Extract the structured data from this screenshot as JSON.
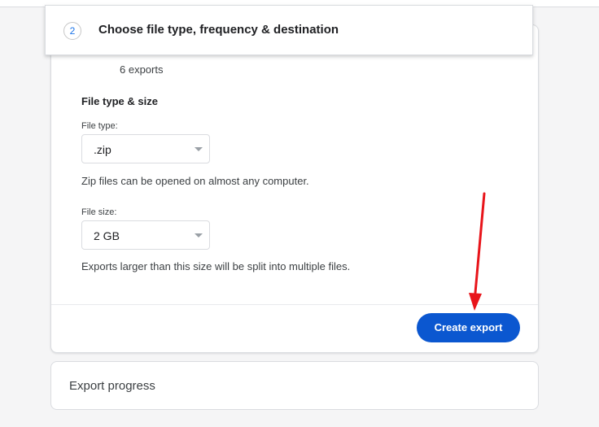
{
  "step": {
    "number": "2",
    "title": "Choose file type, frequency & destination"
  },
  "exports_count": "6 exports",
  "file_section": {
    "heading": "File type & size",
    "type_label": "File type:",
    "type_value": ".zip",
    "type_help": "Zip files can be opened on almost any computer.",
    "size_label": "File size:",
    "size_value": "2 GB",
    "size_help": "Exports larger than this size will be split into multiple files."
  },
  "actions": {
    "create_label": "Create export"
  },
  "progress": {
    "title": "Export progress"
  },
  "colors": {
    "primary": "#0b57d0",
    "annotation_arrow": "#e8141a"
  },
  "icons": {
    "caret": "chevron-down-icon",
    "annotation": "red-arrow"
  }
}
